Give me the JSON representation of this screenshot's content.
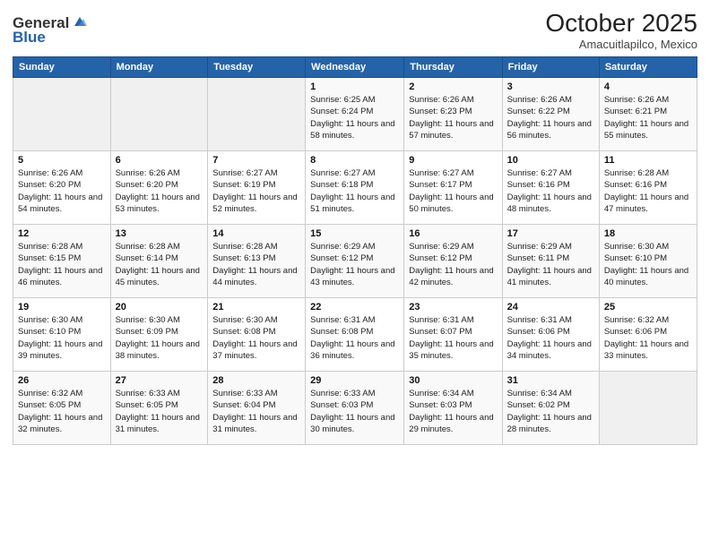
{
  "header": {
    "logo_general": "General",
    "logo_blue": "Blue",
    "month": "October 2025",
    "location": "Amacuitlapilco, Mexico"
  },
  "weekdays": [
    "Sunday",
    "Monday",
    "Tuesday",
    "Wednesday",
    "Thursday",
    "Friday",
    "Saturday"
  ],
  "weeks": [
    [
      {
        "day": "",
        "info": ""
      },
      {
        "day": "",
        "info": ""
      },
      {
        "day": "",
        "info": ""
      },
      {
        "day": "1",
        "info": "Sunrise: 6:25 AM\nSunset: 6:24 PM\nDaylight: 11 hours and 58 minutes."
      },
      {
        "day": "2",
        "info": "Sunrise: 6:26 AM\nSunset: 6:23 PM\nDaylight: 11 hours and 57 minutes."
      },
      {
        "day": "3",
        "info": "Sunrise: 6:26 AM\nSunset: 6:22 PM\nDaylight: 11 hours and 56 minutes."
      },
      {
        "day": "4",
        "info": "Sunrise: 6:26 AM\nSunset: 6:21 PM\nDaylight: 11 hours and 55 minutes."
      }
    ],
    [
      {
        "day": "5",
        "info": "Sunrise: 6:26 AM\nSunset: 6:20 PM\nDaylight: 11 hours and 54 minutes."
      },
      {
        "day": "6",
        "info": "Sunrise: 6:26 AM\nSunset: 6:20 PM\nDaylight: 11 hours and 53 minutes."
      },
      {
        "day": "7",
        "info": "Sunrise: 6:27 AM\nSunset: 6:19 PM\nDaylight: 11 hours and 52 minutes."
      },
      {
        "day": "8",
        "info": "Sunrise: 6:27 AM\nSunset: 6:18 PM\nDaylight: 11 hours and 51 minutes."
      },
      {
        "day": "9",
        "info": "Sunrise: 6:27 AM\nSunset: 6:17 PM\nDaylight: 11 hours and 50 minutes."
      },
      {
        "day": "10",
        "info": "Sunrise: 6:27 AM\nSunset: 6:16 PM\nDaylight: 11 hours and 48 minutes."
      },
      {
        "day": "11",
        "info": "Sunrise: 6:28 AM\nSunset: 6:16 PM\nDaylight: 11 hours and 47 minutes."
      }
    ],
    [
      {
        "day": "12",
        "info": "Sunrise: 6:28 AM\nSunset: 6:15 PM\nDaylight: 11 hours and 46 minutes."
      },
      {
        "day": "13",
        "info": "Sunrise: 6:28 AM\nSunset: 6:14 PM\nDaylight: 11 hours and 45 minutes."
      },
      {
        "day": "14",
        "info": "Sunrise: 6:28 AM\nSunset: 6:13 PM\nDaylight: 11 hours and 44 minutes."
      },
      {
        "day": "15",
        "info": "Sunrise: 6:29 AM\nSunset: 6:12 PM\nDaylight: 11 hours and 43 minutes."
      },
      {
        "day": "16",
        "info": "Sunrise: 6:29 AM\nSunset: 6:12 PM\nDaylight: 11 hours and 42 minutes."
      },
      {
        "day": "17",
        "info": "Sunrise: 6:29 AM\nSunset: 6:11 PM\nDaylight: 11 hours and 41 minutes."
      },
      {
        "day": "18",
        "info": "Sunrise: 6:30 AM\nSunset: 6:10 PM\nDaylight: 11 hours and 40 minutes."
      }
    ],
    [
      {
        "day": "19",
        "info": "Sunrise: 6:30 AM\nSunset: 6:10 PM\nDaylight: 11 hours and 39 minutes."
      },
      {
        "day": "20",
        "info": "Sunrise: 6:30 AM\nSunset: 6:09 PM\nDaylight: 11 hours and 38 minutes."
      },
      {
        "day": "21",
        "info": "Sunrise: 6:30 AM\nSunset: 6:08 PM\nDaylight: 11 hours and 37 minutes."
      },
      {
        "day": "22",
        "info": "Sunrise: 6:31 AM\nSunset: 6:08 PM\nDaylight: 11 hours and 36 minutes."
      },
      {
        "day": "23",
        "info": "Sunrise: 6:31 AM\nSunset: 6:07 PM\nDaylight: 11 hours and 35 minutes."
      },
      {
        "day": "24",
        "info": "Sunrise: 6:31 AM\nSunset: 6:06 PM\nDaylight: 11 hours and 34 minutes."
      },
      {
        "day": "25",
        "info": "Sunrise: 6:32 AM\nSunset: 6:06 PM\nDaylight: 11 hours and 33 minutes."
      }
    ],
    [
      {
        "day": "26",
        "info": "Sunrise: 6:32 AM\nSunset: 6:05 PM\nDaylight: 11 hours and 32 minutes."
      },
      {
        "day": "27",
        "info": "Sunrise: 6:33 AM\nSunset: 6:05 PM\nDaylight: 11 hours and 31 minutes."
      },
      {
        "day": "28",
        "info": "Sunrise: 6:33 AM\nSunset: 6:04 PM\nDaylight: 11 hours and 31 minutes."
      },
      {
        "day": "29",
        "info": "Sunrise: 6:33 AM\nSunset: 6:03 PM\nDaylight: 11 hours and 30 minutes."
      },
      {
        "day": "30",
        "info": "Sunrise: 6:34 AM\nSunset: 6:03 PM\nDaylight: 11 hours and 29 minutes."
      },
      {
        "day": "31",
        "info": "Sunrise: 6:34 AM\nSunset: 6:02 PM\nDaylight: 11 hours and 28 minutes."
      },
      {
        "day": "",
        "info": ""
      }
    ]
  ]
}
